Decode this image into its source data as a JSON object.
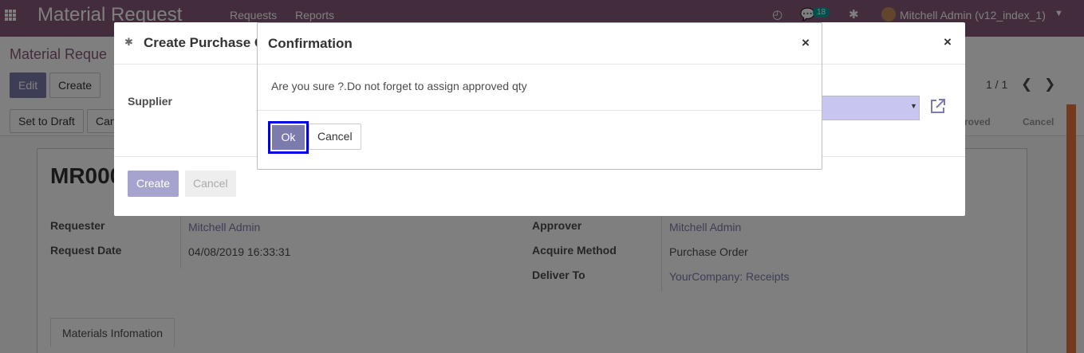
{
  "navbar": {
    "brand": "Material Request",
    "menu": [
      "Requests",
      "Reports"
    ],
    "chat_badge": "18",
    "user": "Mitchell Admin (v12_index_1)"
  },
  "control_panel": {
    "breadcrumb": "Material Reque",
    "edit_label": "Edit",
    "create_label": "Create",
    "set_to_draft_label": "Set to Draft",
    "cancel_partial": "Can",
    "pager": "1 / 1",
    "status_approved": "roved",
    "status_cancel": "Cancel"
  },
  "form": {
    "name": "MR000",
    "requester_label": "Requester",
    "requester_value": "Mitchell Admin",
    "request_date_label": "Request Date",
    "request_date_value": "04/08/2019 16:33:31",
    "approver_label": "Approver",
    "approver_value": "Mitchell Admin",
    "acquire_method_label": "Acquire Method",
    "acquire_method_value": "Purchase Order",
    "deliver_to_label": "Deliver To",
    "deliver_to_value": "YourCompany: Receipts",
    "tab_label": "Materials Infomation"
  },
  "po_dialog": {
    "title": "Create Purchase O",
    "supplier_label": "Supplier",
    "create_label": "Create",
    "cancel_label": "Cancel"
  },
  "confirm_dialog": {
    "title": "Confirmation",
    "message": "Are you sure ?.Do not forget to assign approved qty",
    "ok_label": "Ok",
    "cancel_label": "Cancel"
  },
  "colors": {
    "brand": "#875a7b",
    "primary": "#7c7bad",
    "focus_outline": "#0000e6",
    "supplier_field": "#c8c6f0"
  }
}
